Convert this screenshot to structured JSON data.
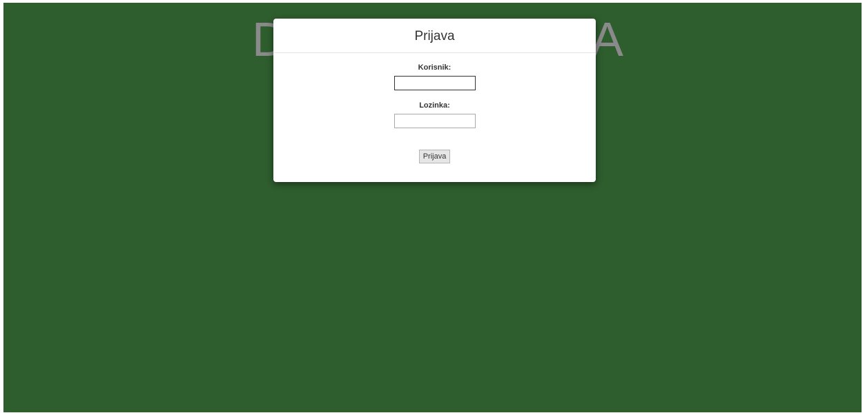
{
  "background": {
    "color": "#2e5d2e",
    "title_left": "D",
    "title_right": "A"
  },
  "login_dialog": {
    "title": "Prijava",
    "username_label": "Korisnik:",
    "username_value": "",
    "password_label": "Lozinka:",
    "password_value": "",
    "submit_label": "Prijava"
  }
}
